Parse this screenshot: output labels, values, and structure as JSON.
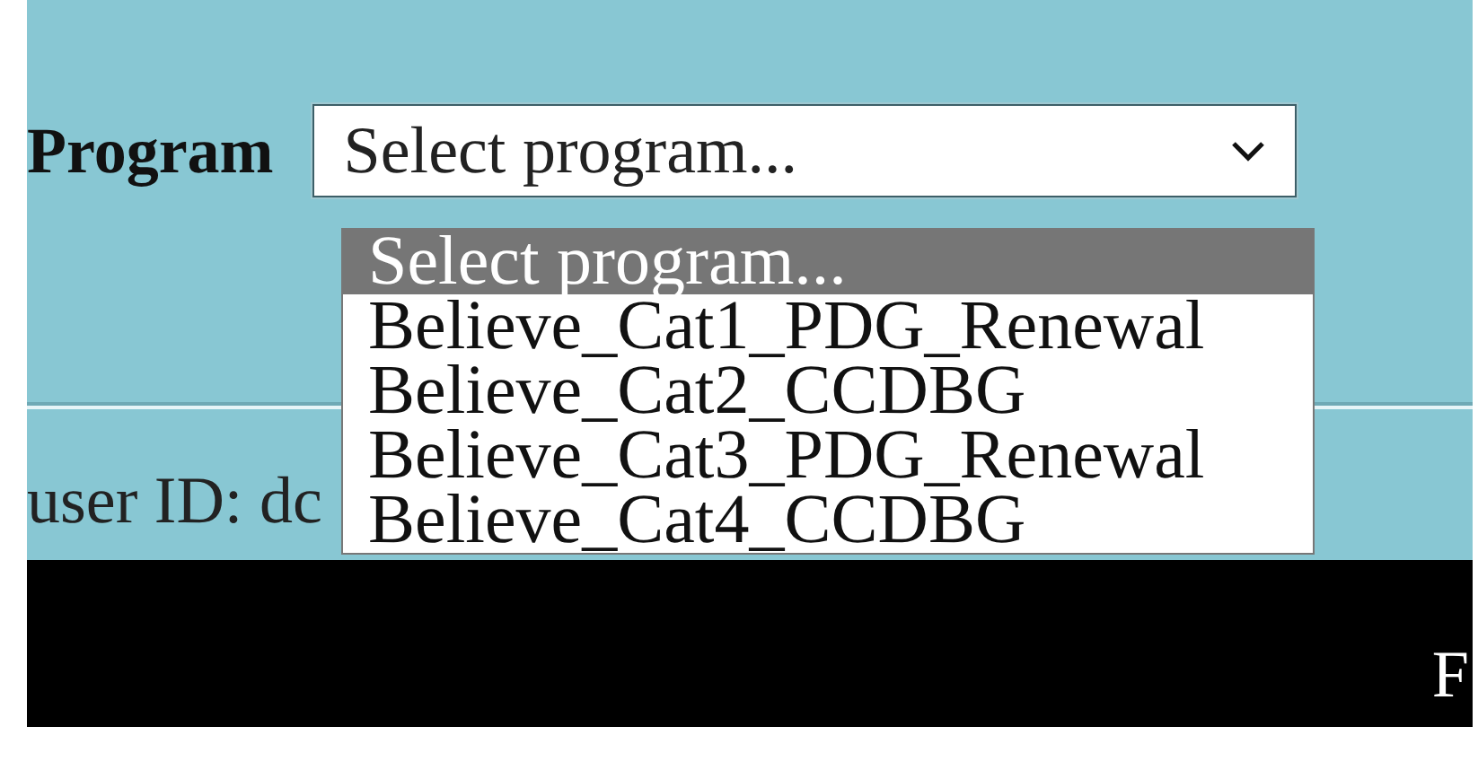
{
  "filter": {
    "label": "Program",
    "select": {
      "value": "Select program...",
      "expanded": true
    }
  },
  "options": [
    {
      "label": "Select program...",
      "selected": true
    },
    {
      "label": "Believe_Cat1_PDG_Renewal",
      "selected": false
    },
    {
      "label": "Believe_Cat2_CCDBG",
      "selected": false
    },
    {
      "label": "Believe_Cat3_PDG_Renewal",
      "selected": false
    },
    {
      "label": "Believe_Cat4_CCDBG",
      "selected": false
    }
  ],
  "user_line": "user ID: dc",
  "nav_bar": {
    "text": "F"
  }
}
